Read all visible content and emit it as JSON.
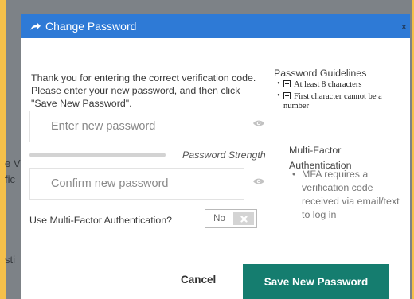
{
  "dialog": {
    "title": "Change Password",
    "close_glyph": "×",
    "intro": "Thank you for entering the correct verification code. Please enter your new password, and then click \"Save New Password\".",
    "new_password_placeholder": "Enter new password",
    "confirm_password_placeholder": "Confirm new password",
    "strength_label": "Password Strength",
    "mfa_question": "Use Multi-Factor Authentication?",
    "mfa_toggle_value": "No",
    "guidelines_title": "Password Guidelines",
    "guidelines": [
      "At least 8 characters",
      "First character cannot be a number"
    ],
    "mfa_heading": "Multi-Factor Authentication",
    "mfa_note": "MFA requires a verification code received via email/text to log in",
    "cancel_label": "Cancel",
    "save_label": "Save New Password"
  },
  "underlay": {
    "fragments": [
      "e V",
      "fic",
      "sti"
    ]
  },
  "colors": {
    "header_bg": "#2e7ad6",
    "save_bg": "#157d6f",
    "outer_bg": "#f5c04a"
  }
}
